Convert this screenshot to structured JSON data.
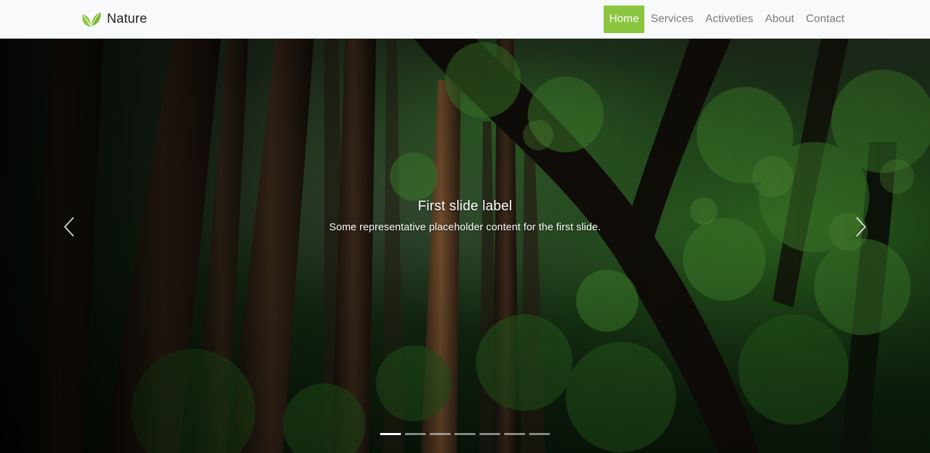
{
  "brand": {
    "name": "Nature",
    "logo_icon": "leaf-icon",
    "logo_color": "#8cc63f"
  },
  "nav": {
    "items": [
      {
        "label": "Home",
        "active": true
      },
      {
        "label": "Services",
        "active": false
      },
      {
        "label": "Activeties",
        "active": false
      },
      {
        "label": "About",
        "active": false
      },
      {
        "label": "Contact",
        "active": false
      }
    ],
    "active_color": "#8cc63f"
  },
  "carousel": {
    "background": "forest-image",
    "caption": {
      "title": "First slide label",
      "text": "Some representative placeholder content for the first slide."
    },
    "prev_icon": "chevron-left-icon",
    "next_icon": "chevron-right-icon",
    "slide_count": 7,
    "active_slide": 1
  }
}
